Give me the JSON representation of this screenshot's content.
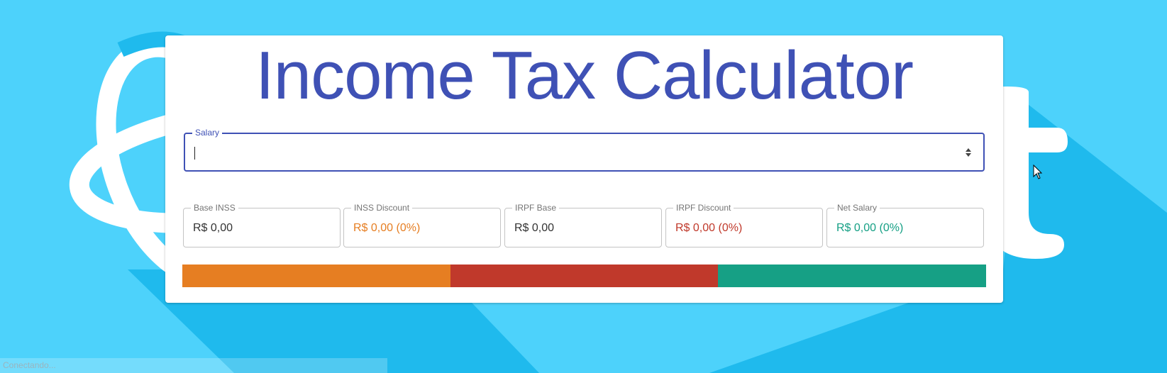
{
  "app": {
    "title": "Income Tax Calculator"
  },
  "salary": {
    "label": "Salary",
    "value": ""
  },
  "fields": [
    {
      "label": "Base INSS",
      "value": "R$ 0,00",
      "color": "#333333"
    },
    {
      "label": "INSS Discount",
      "value": "R$ 0,00 (0%)",
      "color": "#e67e22"
    },
    {
      "label": "IRPF Base",
      "value": "R$ 0,00",
      "color": "#333333"
    },
    {
      "label": "IRPF Discount",
      "value": "R$ 0,00 (0%)",
      "color": "#c0392b"
    },
    {
      "label": "Net Salary",
      "value": "R$ 0,00 (0%)",
      "color": "#16a085"
    }
  ],
  "bar": {
    "segments": [
      {
        "name": "INSS Discount",
        "color": "#e67e22"
      },
      {
        "name": "IRPF Discount",
        "color": "#c0392b"
      },
      {
        "name": "Net Salary",
        "color": "#16a085"
      }
    ]
  },
  "status_bar": {
    "text": "Conectando..."
  },
  "colors": {
    "accent": "#3f51b5",
    "background": "#4dd2fb"
  }
}
